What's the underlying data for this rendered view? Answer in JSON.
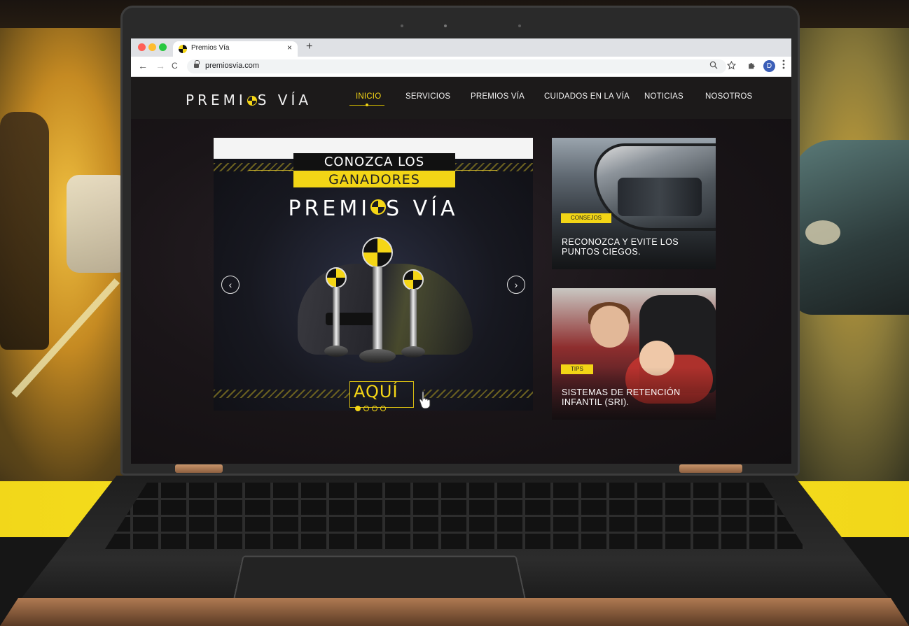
{
  "browser": {
    "tab_title": "Premios Vía",
    "tab_close": "×",
    "new_tab": "+",
    "url": "premiosvia.com",
    "nav": {
      "back": "←",
      "forward": "→",
      "reload": "C"
    },
    "icons": {
      "zoom": "search-icon",
      "bookmark": "star-icon",
      "extensions": "puzzle-icon",
      "menu": "kebab-menu-icon"
    },
    "profile_initial": "D",
    "window_controls": {
      "close_color": "#ff5f57",
      "minimize_color": "#febc2e",
      "maximize_color": "#28c840"
    }
  },
  "site": {
    "logo_left": "PREMI",
    "logo_right": "S VÍA",
    "nav": [
      {
        "label": "INICIO",
        "active": true
      },
      {
        "label": "SERVICIOS",
        "active": false
      },
      {
        "label": "PREMIOS VÍA",
        "active": false
      },
      {
        "label": "CUIDADOS EN LA VÍA",
        "active": false
      },
      {
        "label": "NOTICIAS",
        "active": false
      },
      {
        "label": "NOSOTROS",
        "active": false
      }
    ],
    "accent": "#f5d616",
    "hero": {
      "line1": "CONOZCA LOS",
      "line2": "GANADORES",
      "brand_left": "PREMI",
      "brand_right": "S VÍA",
      "cta": "AQUÍ",
      "prev": "‹",
      "next": "›",
      "slides_total": 4,
      "slide_active": 1
    },
    "cards": [
      {
        "tag": "CONSEJOS",
        "title": "RECONOZCA Y EVITE LOS PUNTOS CIEGOS."
      },
      {
        "tag": "TIPS",
        "title": "SISTEMAS DE RETENCIÓN INFANTIL (SRI)."
      }
    ]
  }
}
